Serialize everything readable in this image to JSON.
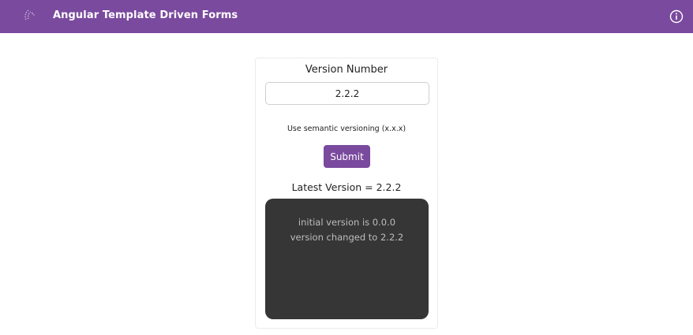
{
  "app": {
    "title": "Angular Template Driven Forms",
    "logo_icon": "angular-logo-icon",
    "info_icon": "info-circle-icon",
    "accent_color": "#7a4a9e"
  },
  "form": {
    "label": "Version Number",
    "input_value": "2.2.2",
    "hint": "Use semantic versioning (x.x.x)",
    "submit_label": "Submit"
  },
  "latest": {
    "label": "Latest Version =",
    "value": "2.2.2"
  },
  "log": {
    "background_color": "#363636",
    "lines": [
      "initial version is 0.0.0",
      "version changed to 2.2.2"
    ]
  }
}
